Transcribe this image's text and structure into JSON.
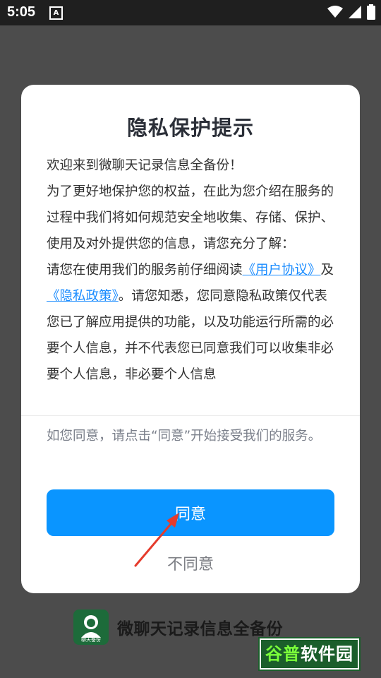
{
  "status_bar": {
    "time": "5:05",
    "notification_badge": "A"
  },
  "dialog": {
    "title": "隐私保护提示",
    "greeting": "欢迎来到微聊天记录信息全备份！",
    "paragraph1": "为了更好地保护您的权益，在此为您介绍在服务的过程中我们将如何规范安全地收集、存储、保护、使用及对外提供您的信息，请您充分了解：",
    "paragraph2_prefix": "请您在使用我们的服务前仔细阅读",
    "user_agreement_link": "《用户协议》",
    "and_text": "及",
    "privacy_policy_link": "《隐私政策》",
    "paragraph2_suffix": "。请您知悉，您同意隐私政策仅代表您已了解应用提供的功能，以及功能运行所需的必要个人信息，并不代表您已同意我们可以收集非必要个人信息，非必要个人信息",
    "note": "如您同意，请点击“同意”开始接受我们的服务。",
    "agree_label": "同意",
    "disagree_label": "不同意"
  },
  "footer": {
    "app_name": "微聊天记录信息全备份",
    "logo_caption": "聊天备份"
  },
  "watermark": {
    "part1": "谷普",
    "part2": "软件园"
  },
  "colors": {
    "primary": "#0a95ff",
    "link": "#1a8cff",
    "arrow": "#e53b2c",
    "overlay": "#4c4c4c"
  },
  "icons": [
    "wifi-icon",
    "signal-icon",
    "battery-icon",
    "arrow-annotation-icon"
  ]
}
